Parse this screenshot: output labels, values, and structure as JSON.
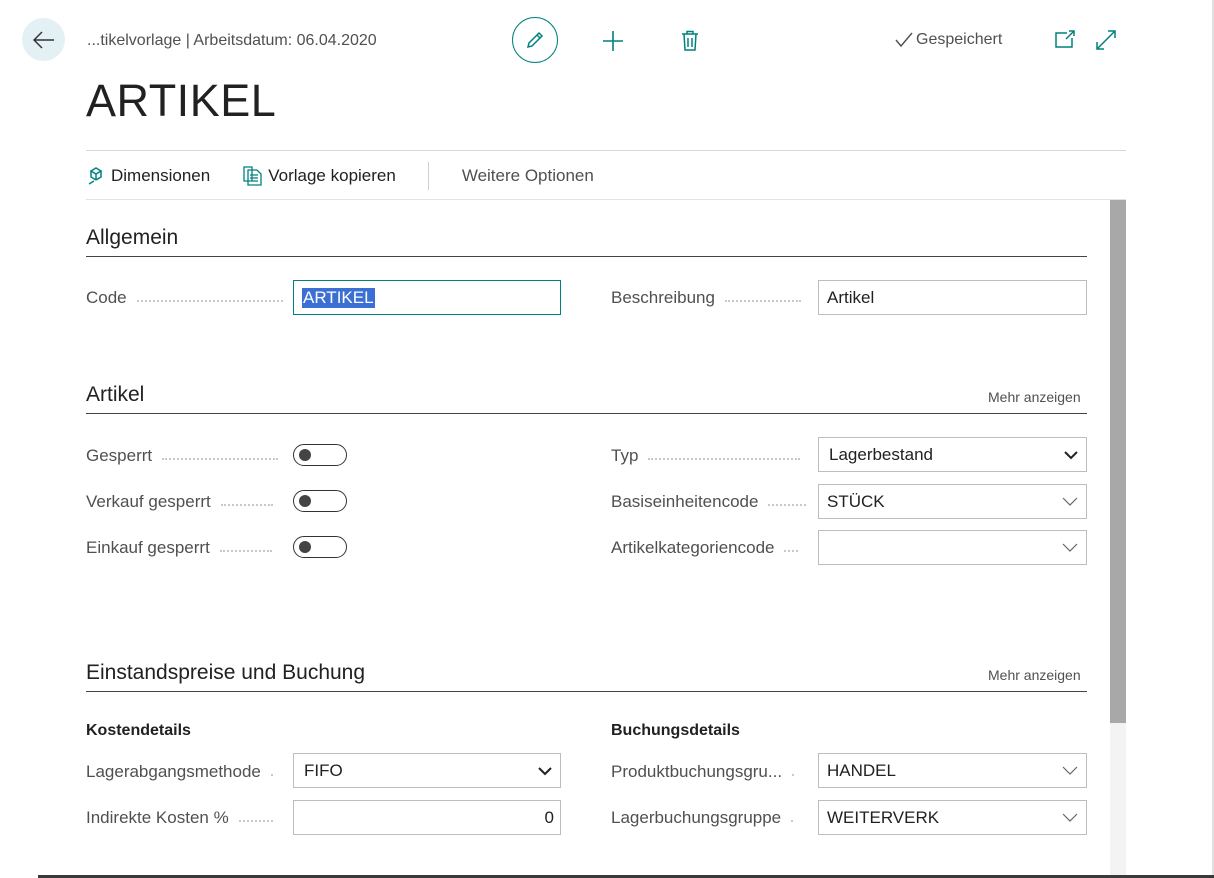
{
  "header": {
    "breadcrumb": "...tikelvorlage | Arbeitsdatum: 06.04.2020",
    "saved_label": "Gespeichert",
    "page_title": "ARTIKEL"
  },
  "actions": {
    "dimensionen": "Dimensionen",
    "vorlage_kopieren": "Vorlage kopieren",
    "weitere_optionen": "Weitere Optionen"
  },
  "sections": {
    "allgemein": {
      "title": "Allgemein",
      "code_label": "Code",
      "code_value": "ARTIKEL",
      "beschreibung_label": "Beschreibung",
      "beschreibung_value": "Artikel"
    },
    "artikel": {
      "title": "Artikel",
      "more": "Mehr anzeigen",
      "gesperrt_label": "Gesperrt",
      "verkauf_gesperrt_label": "Verkauf gesperrt",
      "einkauf_gesperrt_label": "Einkauf gesperrt",
      "toggles": {
        "gesperrt": false,
        "verkauf_gesperrt": false,
        "einkauf_gesperrt": false
      },
      "typ_label": "Typ",
      "typ_value": "Lagerbestand",
      "basiseinheit_label": "Basiseinheitencode",
      "basiseinheit_value": "STÜCK",
      "kategorie_label": "Artikelkategoriencode",
      "kategorie_value": ""
    },
    "einstand": {
      "title": "Einstandspreise und Buchung",
      "more": "Mehr anzeigen",
      "kostendetails": "Kostendetails",
      "buchungsdetails": "Buchungsdetails",
      "lagerabgang_label": "Lagerabgangsmethode",
      "lagerabgang_value": "FIFO",
      "indirekte_label": "Indirekte Kosten %",
      "indirekte_value": "0",
      "produktbuchung_label": "Produktbuchungsgru...",
      "produktbuchung_value": "HANDEL",
      "lagerbuchung_label": "Lagerbuchungsgruppe",
      "lagerbuchung_value": "WEITERVERK"
    }
  },
  "colors": {
    "accent": "#00817d",
    "selection": "#3b6fd4"
  }
}
